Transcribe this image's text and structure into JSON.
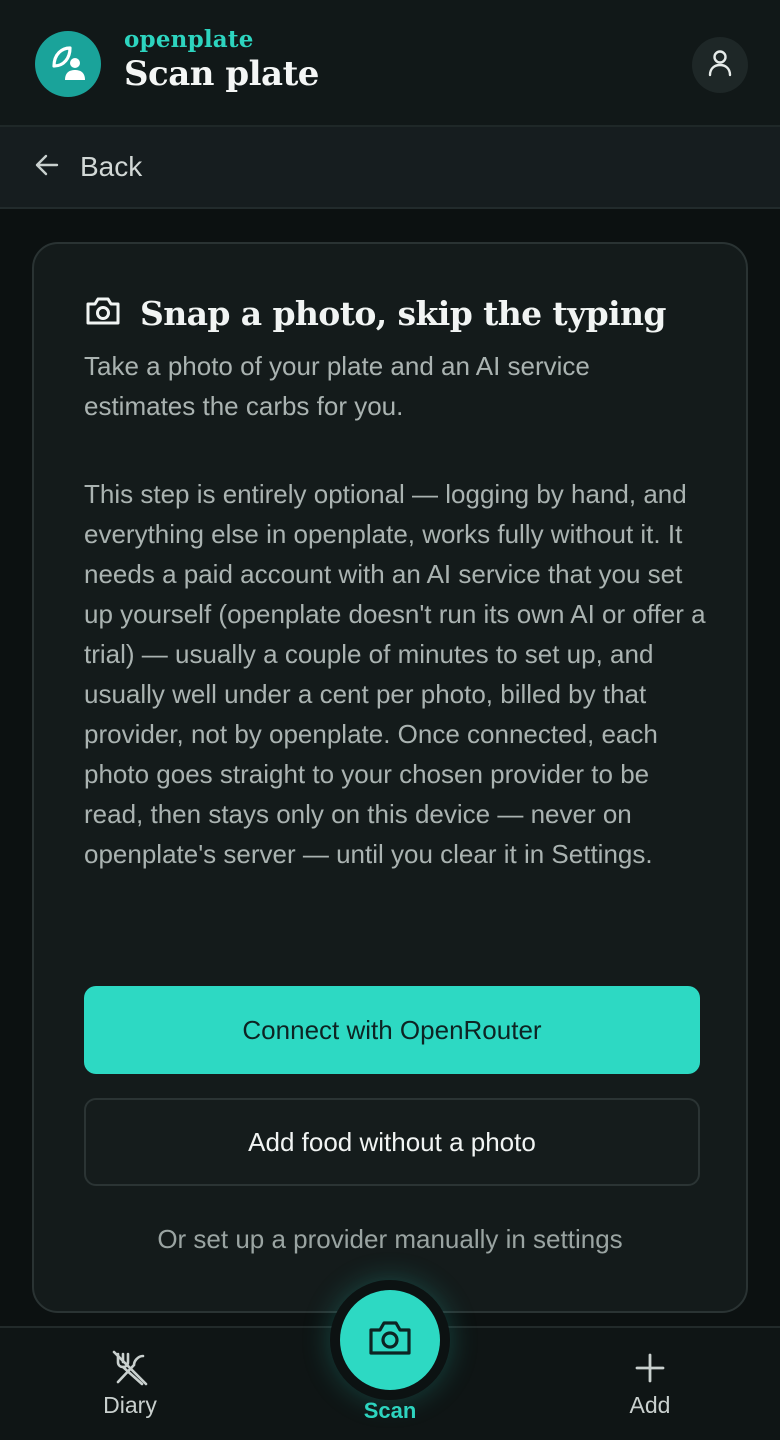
{
  "header": {
    "brand": "openplate",
    "title": "Scan plate"
  },
  "back": {
    "label": "Back"
  },
  "card": {
    "heading": "Snap a photo, skip the typing",
    "intro": "Take a photo of your plate and an AI service estimates the carbs for you.",
    "body": "This step is entirely optional — logging by hand, and everything else in openplate, works fully without it. It needs a paid account with an AI service that you set up yourself (openplate doesn't run its own AI or offer a trial) — usually a couple of minutes to set up, and usually well under a cent per photo, billed by that provider, not by openplate. Once connected, each photo goes straight to your chosen provider to be read, then stays only on this device — never on openplate's server — until you clear it in Settings.",
    "primary_button": "Connect with OpenRouter",
    "secondary_button": "Add food without a photo",
    "manual_link": "Or set up a provider manually in settings"
  },
  "nav": {
    "diary": "Diary",
    "scan": "Scan",
    "add": "Add"
  },
  "colors": {
    "accent": "#2dd9c3",
    "brand_text": "#2dd4bf",
    "logo_bg": "#1aa39a",
    "background": "#0c1111"
  },
  "icons": {
    "logo": "leaf-person-icon",
    "profile": "user-icon",
    "back": "arrow-left-icon",
    "heading": "camera-icon",
    "diary": "fork-knife-crossed-icon",
    "scan": "camera-icon",
    "add": "plus-icon"
  }
}
